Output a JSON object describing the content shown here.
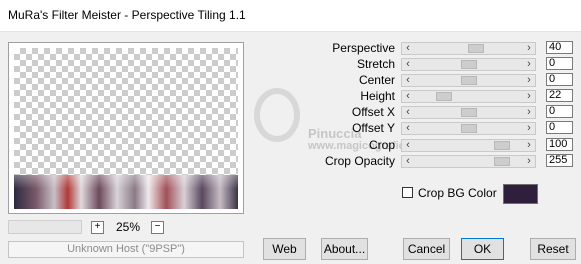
{
  "window": {
    "title": "MuRa's Filter Meister - Perspective Tiling 1.1"
  },
  "preview": {
    "zoom_value": "25%",
    "zoom_plus": "+",
    "zoom_minus": "−"
  },
  "status": {
    "host": "Unknown Host (\"9PSP\")"
  },
  "controls": [
    {
      "label": "Perspective",
      "value": "40",
      "level": 0.58
    },
    {
      "label": "Stretch",
      "value": "0",
      "level": 0.5
    },
    {
      "label": "Center",
      "value": "0",
      "level": 0.5
    },
    {
      "label": "Height",
      "value": "22",
      "level": 0.24
    },
    {
      "label": "Offset X",
      "value": "0",
      "level": 0.5
    },
    {
      "label": "Offset Y",
      "value": "0",
      "level": 0.5
    },
    {
      "label": "Crop",
      "value": "100",
      "level": 0.86
    },
    {
      "label": "Crop Opacity",
      "value": "255",
      "level": 0.86
    }
  ],
  "crop_bg": {
    "label": "Crop BG Color",
    "checked": false,
    "color": "#2f1f3c"
  },
  "buttons": {
    "web": "Web",
    "about": "About...",
    "cancel": "Cancel",
    "ok": "OK",
    "reset": "Reset"
  },
  "watermark": {
    "line1": "Pinuccia",
    "line2": "www.magicografica.eu"
  },
  "icons": {
    "slider_left": "chevron-left-icon",
    "slider_right": "chevron-right-icon"
  }
}
